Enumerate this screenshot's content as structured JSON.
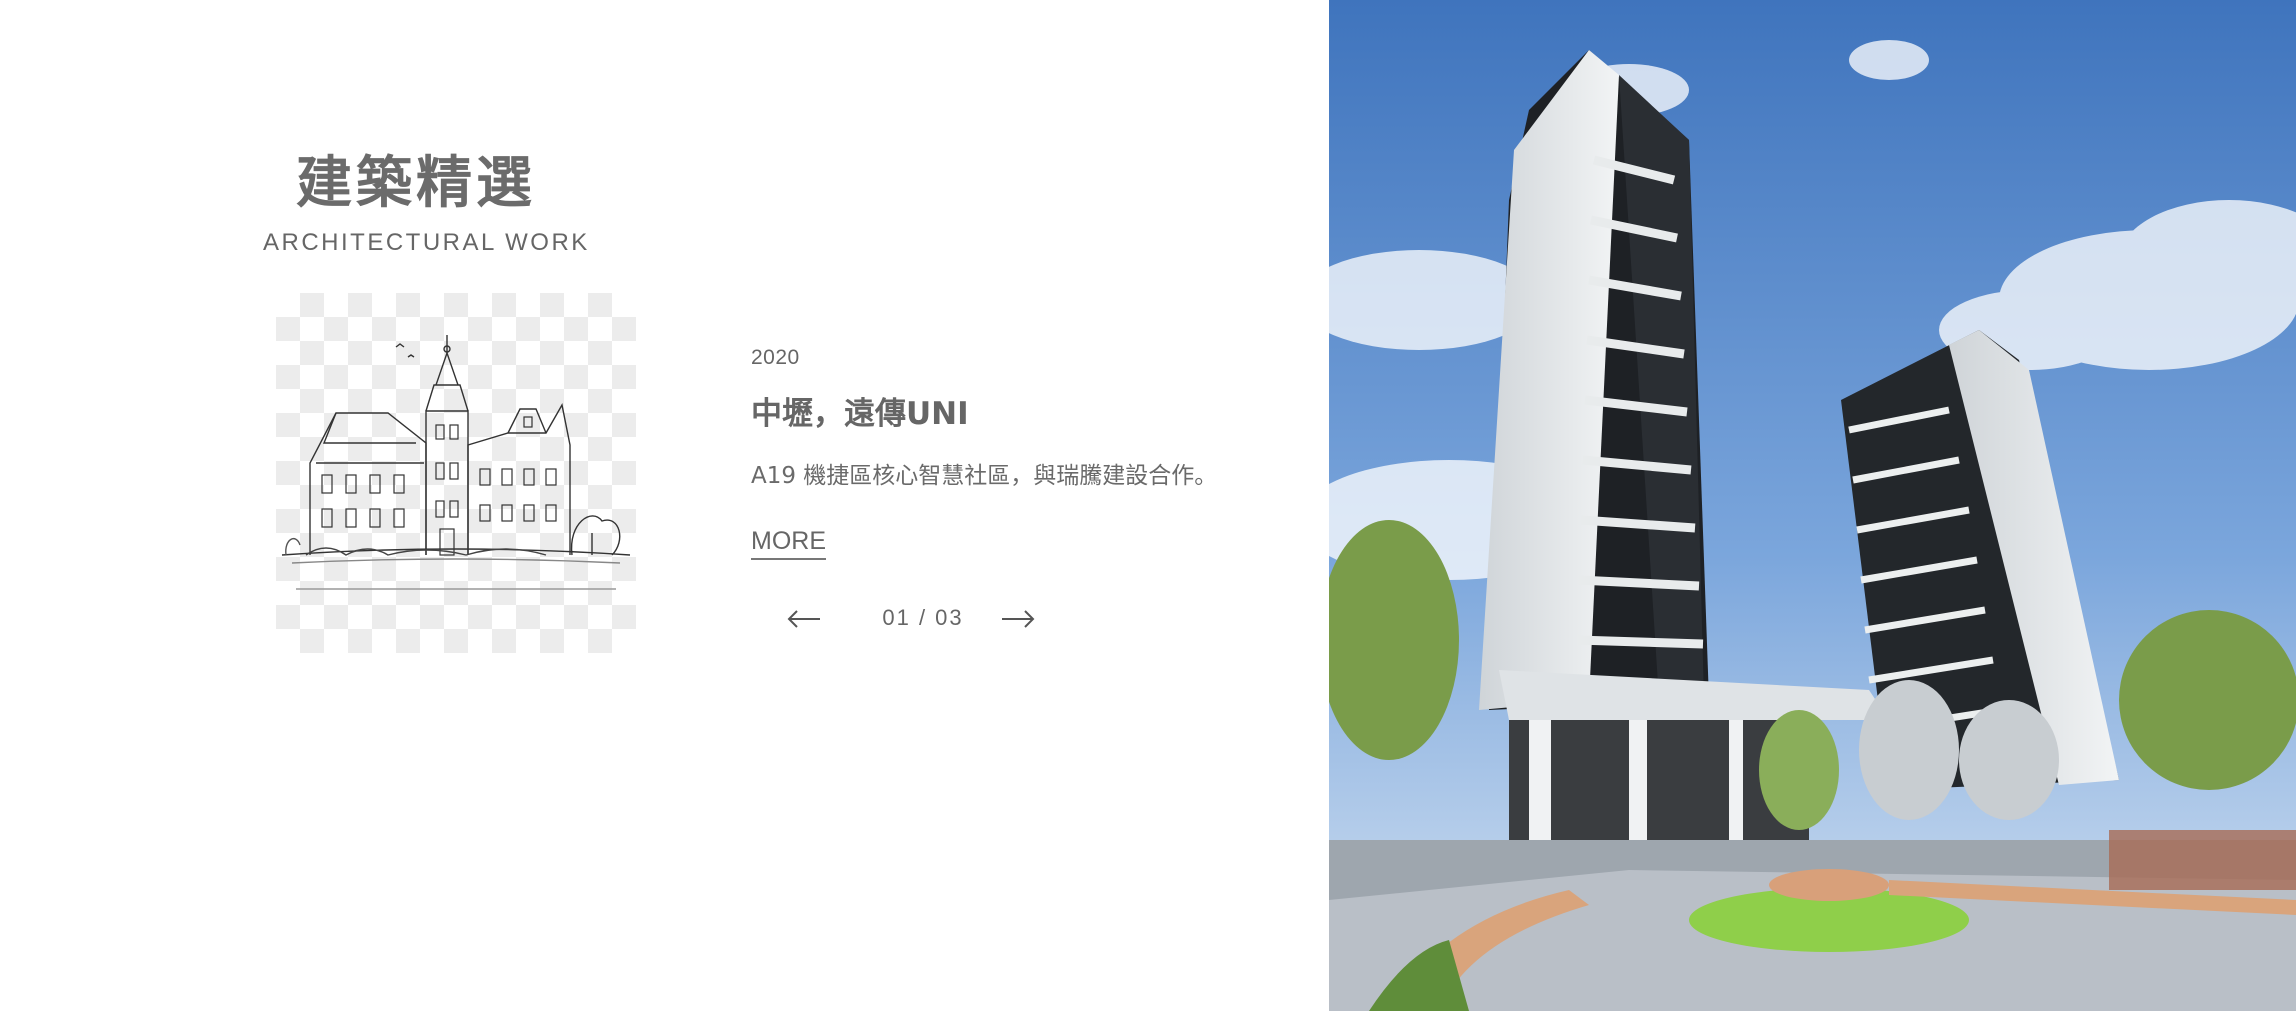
{
  "section": {
    "title": "建築精選",
    "subtitle": "ARCHITECTURAL WORK"
  },
  "project": {
    "year": "2020",
    "title": "中壢，遠傳UNI",
    "description": "A19 機捷區核心智慧社區，與瑞騰建設合作。",
    "more_label": "MORE"
  },
  "pager": {
    "current": "01",
    "separator": " / ",
    "total": "03",
    "text": "01 / 03"
  },
  "colors": {
    "text": "#666666",
    "sky": "#4a7fc3",
    "building": "#e9ecee"
  },
  "icons": {
    "prev": "arrow-left-icon",
    "next": "arrow-right-icon"
  }
}
